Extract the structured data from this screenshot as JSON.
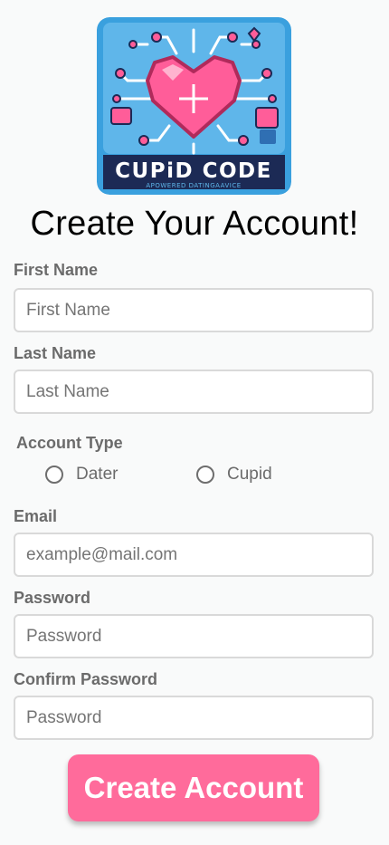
{
  "logo": {
    "name": "CUPiD CODE",
    "tagline": "APOWERED DATINGAAVICE",
    "colors": {
      "frame": "#3aa0de",
      "panel": "#5fb6ea",
      "heart": "#ff5d99",
      "circuit": "#ffffff",
      "banner": "#1c2a55"
    }
  },
  "page_title": "Create Your Account!",
  "form": {
    "first_name": {
      "label": "First Name",
      "placeholder": "First Name"
    },
    "last_name": {
      "label": "Last Name",
      "placeholder": "Last Name"
    },
    "account_type": {
      "label": "Account Type",
      "options": [
        {
          "label": "Dater"
        },
        {
          "label": "Cupid"
        }
      ]
    },
    "email": {
      "label": "Email",
      "placeholder": "example@mail.com"
    },
    "password": {
      "label": "Password",
      "placeholder": "Password"
    },
    "confirm_password": {
      "label": "Confirm Password",
      "placeholder": "Password"
    },
    "submit_label": "Create Account"
  },
  "colors": {
    "accent": "#ff6b9b",
    "label_text": "#6b6b6b",
    "input_border": "#d9d9d9",
    "background": "#f9fafa"
  }
}
